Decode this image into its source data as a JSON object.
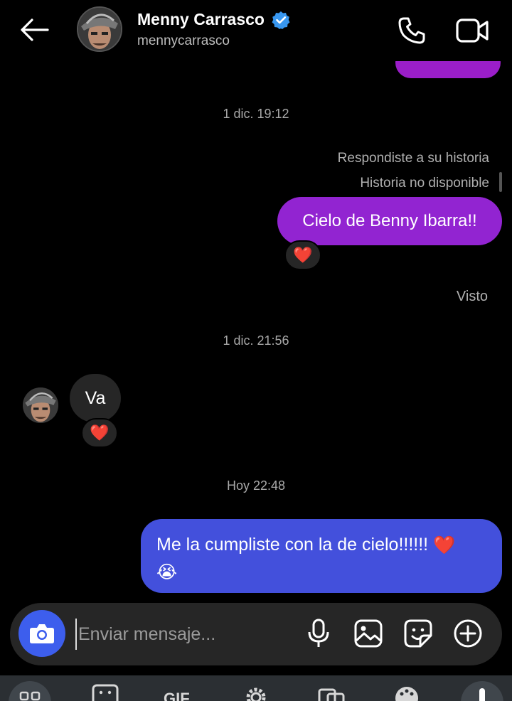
{
  "header": {
    "name": "Menny Carrasco",
    "username": "mennycarrasco",
    "verified": true,
    "icons": [
      "back-arrow-icon",
      "verified-badge-icon",
      "phone-icon",
      "video-icon"
    ]
  },
  "messages": {
    "sep1": "1 dic. 19:12",
    "story_reply": "Respondiste a su historia",
    "story_unavailable": "Historia no disponible",
    "out1": "Cielo de Benny Ibarra!!",
    "out1_reaction": "❤️",
    "seen": "Visto",
    "sep2": "1 dic. 21:56",
    "in1": "Va",
    "in1_reaction": "❤️",
    "sep3": "Hoy 22:48",
    "out2_text": "Me la cumpliste con la de cielo!!!!!! ",
    "out2_emoji_heart": "❤️",
    "out2_emoji_cry": "😭"
  },
  "composer": {
    "placeholder": "Enviar mensaje...",
    "icons": [
      "camera-icon",
      "microphone-icon",
      "image-icon",
      "sticker-icon",
      "plus-icon"
    ]
  },
  "keyboard_toolbar": {
    "gif_label": "GIF",
    "icons": [
      "apps-grid-icon",
      "emoji-keyboard-icon",
      "gif-icon",
      "settings-icon",
      "translate-icon",
      "palette-icon",
      "mic-icon"
    ]
  },
  "colors": {
    "background": "#000000",
    "bubble_purple": "#9224d1",
    "bubble_blue": "#4350dc",
    "bubble_incoming": "#262626",
    "camera_button": "#3d5eed",
    "verified_blue": "#3897f0"
  }
}
